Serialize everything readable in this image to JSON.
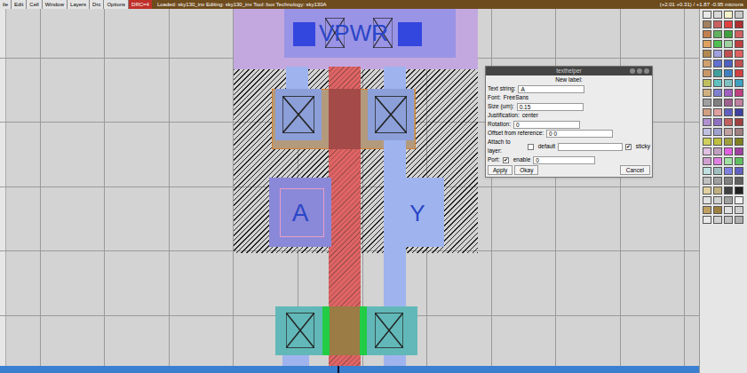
{
  "window": {
    "menu": [
      "ile",
      "Edit",
      "Cell",
      "Window",
      "Layers",
      "Drc",
      "Options"
    ],
    "drc_badge": "DRC=4",
    "status": "Loaded: sky130_inv  Editing: sky130_inv  Tool: box  Technology: sky130A",
    "coords": "(+2.01 +0.31) / +1.87 -0.95 microns"
  },
  "layout_labels": [
    {
      "text": "VPWR",
      "kind": "vpwr"
    },
    {
      "text": "A",
      "kind": "a"
    },
    {
      "text": "Y",
      "kind": "y"
    }
  ],
  "texthelper": {
    "title": "texthelper",
    "heading": "New label:",
    "text_string_label": "Text string:",
    "text_string": "A",
    "font_label": "Font:",
    "font": "FreeSans",
    "size_label": "Size (um):",
    "size": "0.15",
    "justification_label": "Justification:",
    "justification": "center",
    "rotation_label": "Rotation:",
    "rotation": "0",
    "offset_label": "Offset from reference:",
    "offset": "0 0",
    "attach_label": "Attach to layer:",
    "attach_default_label": "default",
    "attach_default": false,
    "attach_layer": "",
    "sticky_label": "sticky",
    "sticky": true,
    "port_label": "Port:",
    "port_enable_label": "enable",
    "port_enable": true,
    "port_index": "0",
    "buttons": [
      "Apply",
      "Okay"
    ],
    "cancel": "Cancel"
  },
  "layer_palette": [
    [
      "#e8e8e8",
      "#d8d8d8",
      "#f4f0c8",
      "#c8c8c8"
    ],
    [
      "#a08060",
      "#c86060",
      "#e04040",
      "#b03030"
    ],
    [
      "#c08050",
      "#60b060",
      "#40a040",
      "#d06060"
    ],
    [
      "#e0a060",
      "#50c050",
      "#a0d0a0",
      "#c04040"
    ],
    [
      "#b08850",
      "#a0a0e0",
      "#c05050",
      "#e06060"
    ],
    [
      "#d0a070",
      "#6070d0",
      "#5060c0",
      "#c05050"
    ],
    [
      "#c89868",
      "#40a0a0",
      "#4080c0",
      "#d04040"
    ],
    [
      "#c0c060",
      "#60c0c0",
      "#80c0c0",
      "#40a0c0"
    ],
    [
      "#d0b080",
      "#8080d0",
      "#a060c0",
      "#c04080"
    ],
    [
      "#a0a0a0",
      "#808080",
      "#a06090",
      "#c080a0"
    ],
    [
      "#d0a080",
      "#e0a0a0",
      "#6060c0",
      "#4040a0"
    ],
    [
      "#b090d0",
      "#9070c0",
      "#c06060",
      "#a04040"
    ],
    [
      "#c0c0e0",
      "#a0a0d0",
      "#c0a0a0",
      "#a08080"
    ],
    [
      "#d0d060",
      "#c0c040",
      "#a0a040",
      "#808020"
    ],
    [
      "#e0c0e0",
      "#c0a0c0",
      "#e060e0",
      "#a040a0"
    ],
    [
      "#d0a0d0",
      "#e080e0",
      "#a0e0a0",
      "#60c060"
    ],
    [
      "#c0e0e0",
      "#a0c0c0",
      "#8080e0",
      "#6060c0"
    ],
    [
      "#c0c0c0",
      "#a0a0a0",
      "#808080",
      "#606060"
    ],
    [
      "#e0d0a0",
      "#c0b080",
      "#404040",
      "#202020"
    ],
    [
      "#e0e0e0",
      "#d0d0d0",
      "#a0a0a0",
      "#f0f0f0"
    ],
    [
      "#c0a060",
      "#a08040",
      "#e0e0e0",
      "#d0d0d0"
    ],
    [
      "#e8e8e8",
      "#d0d0d0",
      "#c0c0c0",
      "#b0b0b0"
    ]
  ]
}
